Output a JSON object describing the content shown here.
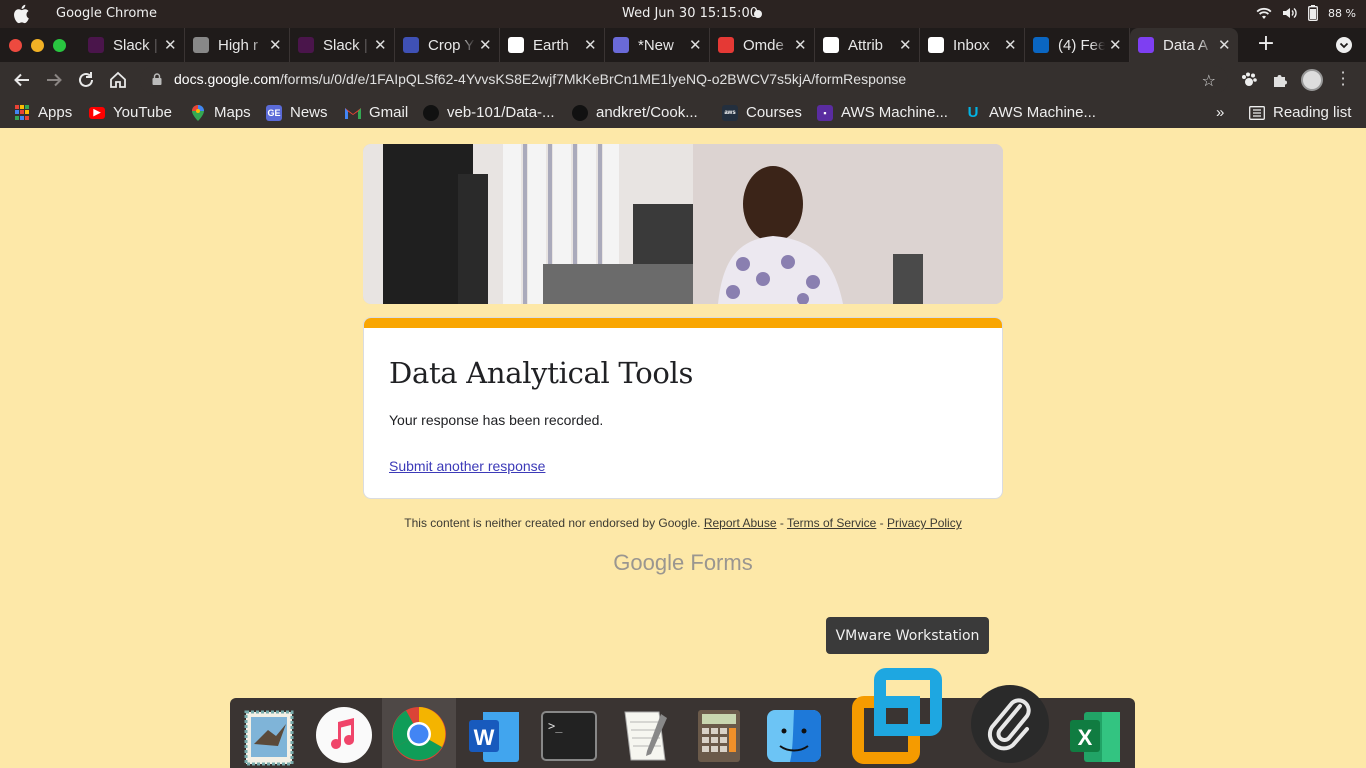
{
  "system_bar": {
    "app_name": "Google Chrome",
    "clock": "Wed Jun 30  15:15:00",
    "battery": "88 %"
  },
  "tabs": [
    {
      "title": "Slack |",
      "favicon_color": "#4a154b",
      "icon": "slack-icon"
    },
    {
      "title": "High r",
      "favicon_color": "#888888",
      "icon": "globe-icon"
    },
    {
      "title": "Slack |",
      "favicon_color": "#4a154b",
      "icon": "slack-icon"
    },
    {
      "title": "Crop Y",
      "favicon_color": "#3f51b5",
      "icon": "crop-icon"
    },
    {
      "title": "Earth",
      "favicon_color": "#ffffff",
      "icon": "earth-icon"
    },
    {
      "title": "*New",
      "favicon_color": "#6a6ad8",
      "icon": "bug-icon"
    },
    {
      "title": "Omde",
      "favicon_color": "#e53935",
      "icon": "omdena-icon"
    },
    {
      "title": "Attrib",
      "favicon_color": "#ffffff",
      "icon": "google-icon"
    },
    {
      "title": "Inbox",
      "favicon_color": "#ffffff",
      "icon": "gmail-icon"
    },
    {
      "title": "(4) Fee",
      "favicon_color": "#0a66c2",
      "icon": "linkedin-icon"
    },
    {
      "title": "Data A",
      "favicon_color": "#7e3ff2",
      "icon": "forms-icon",
      "active": true
    }
  ],
  "toolbar": {
    "url_host": "docs.google.com",
    "url_path": "/forms/u/0/d/e/1FAIpQLSf62-4YvvsKS8E2wjf7MkKeBrCn1ME1lyeNQ-o2BWCV7s5kjA/formResponse"
  },
  "bookmarks": {
    "items": [
      {
        "label": "Apps",
        "icon": "apps-grid-icon"
      },
      {
        "label": "YouTube",
        "icon": "youtube-icon"
      },
      {
        "label": "Maps",
        "icon": "maps-icon"
      },
      {
        "label": "News",
        "icon": "news-icon"
      },
      {
        "label": "Gmail",
        "icon": "gmail-icon"
      },
      {
        "label": "veb-101/Data-...",
        "icon": "github-icon"
      },
      {
        "label": "andkret/Cook...",
        "icon": "github-icon"
      },
      {
        "label": "Courses",
        "icon": "aws-icon"
      },
      {
        "label": "AWS Machine...",
        "icon": "aws-training-icon"
      },
      {
        "label": "AWS Machine...",
        "icon": "udacity-icon"
      }
    ],
    "more": "»",
    "reading_list": "Reading list"
  },
  "form": {
    "title": "Data Analytical Tools",
    "confirmation": "Your response has been recorded.",
    "submit_another": "Submit another response",
    "accent_color": "#f9a602"
  },
  "footer": {
    "disclaimer": "This content is neither created nor endorsed by Google.",
    "report_abuse": "Report Abuse",
    "sep1": " - ",
    "terms": "Terms of Service",
    "sep2": " - ",
    "privacy": "Privacy Policy",
    "brand_google": "Google",
    "brand_forms": "Forms"
  },
  "tooltip": "VMware Workstation",
  "dock": [
    {
      "icon": "mail-icon"
    },
    {
      "icon": "music-icon"
    },
    {
      "icon": "chrome-icon"
    },
    {
      "icon": "word-icon"
    },
    {
      "icon": "terminal-icon"
    },
    {
      "icon": "text-editor-icon"
    },
    {
      "icon": "calculator-icon"
    },
    {
      "icon": "finder-icon"
    },
    {
      "icon": "vmware-icon"
    },
    {
      "icon": "paperclip-icon"
    },
    {
      "icon": "excel-icon"
    }
  ]
}
